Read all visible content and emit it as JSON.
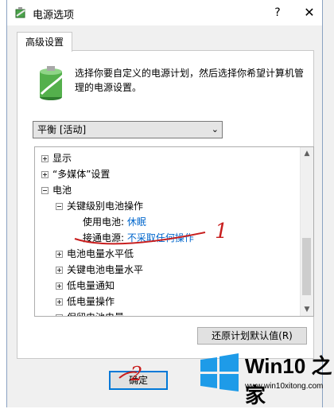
{
  "window": {
    "title": "电源选项",
    "help_label": "?",
    "close_label": "✕"
  },
  "tabs": [
    {
      "label": "高级设置",
      "active": true
    }
  ],
  "description": "选择你要自定义的电源计划，然后选择你希望计算机管理的电源设置。",
  "plan_select": {
    "value": "平衡 [活动]"
  },
  "tree": {
    "items": [
      {
        "label": "显示",
        "expander": "plus"
      },
      {
        "label": "“多媒体”设置",
        "expander": "plus"
      },
      {
        "label": "电池",
        "expander": "minus"
      },
      {
        "label": "关键级别电池操作",
        "expander": "minus"
      },
      {
        "label": "使用电池:",
        "value": "休眠"
      },
      {
        "label": "接通电源:",
        "value": "不采取任何操作"
      },
      {
        "label": "电池电量水平低",
        "expander": "plus"
      },
      {
        "label": "关键电池电量水平",
        "expander": "plus"
      },
      {
        "label": "低电量通知",
        "expander": "plus"
      },
      {
        "label": "低电量操作",
        "expander": "plus"
      },
      {
        "label": "保留电池电量",
        "expander": "plus"
      }
    ]
  },
  "restore_button": {
    "label": "还原计划默认值(R)"
  },
  "ok_button": {
    "label": "确定"
  },
  "annotations": {
    "mark_1": "1",
    "mark_2": "2"
  },
  "watermark": {
    "title": "Win10 之家",
    "url": "www.win10xitong.com"
  },
  "colors": {
    "link_blue": "#0066cc",
    "annotation_red": "#c81e1e",
    "accent": "#0078d7"
  }
}
